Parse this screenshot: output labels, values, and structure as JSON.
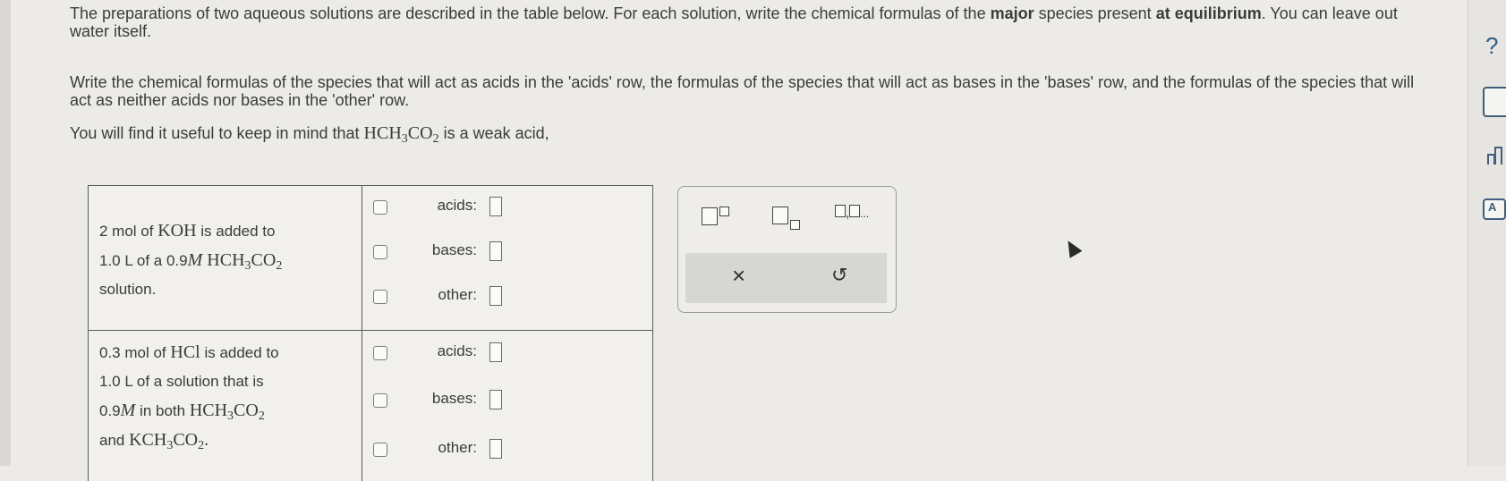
{
  "instructions": {
    "p1_start": "The preparations of two aqueous solutions are described in the table below. For each solution, write the chemical formulas of the ",
    "p1_bold1": "major",
    "p1_mid": " species present ",
    "p1_bold2": "at equilibrium",
    "p1_end": ". You can leave out water itself.",
    "p2": "Write the chemical formulas of the species that will act as acids in the 'acids' row, the formulas of the species that will act as bases in the 'bases' row, and the formulas of the species that will act as neither acids nor bases in the 'other' row.",
    "p3_start": "You will find it useful to keep in mind that ",
    "p3_end": " is a weak acid,"
  },
  "questions": [
    {
      "line1_a": "2 mol of ",
      "line1_b": " is added to",
      "line2_a": "1.0 L of a 0.9",
      "line3": "solution.",
      "rows": [
        "acids:",
        "bases:",
        "other:"
      ]
    },
    {
      "line1_a": "0.3 mol of ",
      "line1_b": " is added to",
      "line2": "1.0 L of a solution that is",
      "line3_a": "0.9",
      "line3_b": " in both ",
      "line4_a": "and ",
      "rows": [
        "acids:",
        "bases:",
        "other:"
      ]
    }
  ],
  "palette": {
    "list_label": ",",
    "ellipsis": "...",
    "clear_icon": "×",
    "undo_icon": "↺"
  },
  "rail": {
    "help_label": "?",
    "text_label": "A"
  },
  "colors": {
    "background": "#ecebe8",
    "text": "#3b3b3b",
    "rail_icon": "#3f5f7c"
  }
}
